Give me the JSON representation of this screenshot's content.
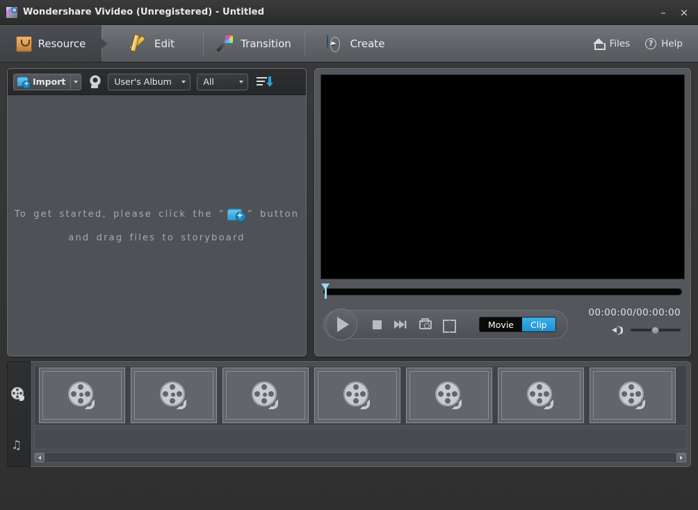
{
  "window": {
    "title": "Wondershare Vivideo (Unregistered) - Untitled",
    "logo_icon": "app-logo-icon",
    "minimize_label": "–",
    "close_label": "×"
  },
  "tabs": [
    {
      "label": "Resource",
      "icon": "shopping-bag-icon",
      "active": true
    },
    {
      "label": "Edit",
      "icon": "pencil-ruler-icon",
      "active": false
    },
    {
      "label": "Transition",
      "icon": "magic-wand-icon",
      "active": false
    },
    {
      "label": "Create",
      "icon": "globe-cursor-icon",
      "active": false
    }
  ],
  "header_links": [
    {
      "label": "Files",
      "icon": "home-icon"
    },
    {
      "label": "Help",
      "icon": "question-circle-icon",
      "glyph": "?"
    }
  ],
  "resource_panel": {
    "toolbar": {
      "import_label": "Import",
      "import_icon": "folder-add-icon",
      "import_dropdown_icon": "chevron-down-icon",
      "webcam_icon": "webcam-icon",
      "album_select": {
        "value": "User's Album",
        "options": [
          "User's Album"
        ]
      },
      "filter_select": {
        "value": "All",
        "options": [
          "All"
        ]
      },
      "sort_icon": "sort-descending-icon"
    },
    "empty_state": {
      "line1_before": "To  get  started,  please  click  the  “",
      "line1_icon": "folder-add-icon",
      "line1_after": "”  button",
      "line2": "and  drag  files  to  storyboard"
    }
  },
  "preview_panel": {
    "video_background": "#000000",
    "seek": {
      "playhead_position_pct": 0,
      "playhead_color": "#9ed4f5"
    },
    "transport": [
      {
        "name": "play-button",
        "icon": "play-icon"
      },
      {
        "name": "stop-button",
        "icon": "stop-icon"
      },
      {
        "name": "next-frame-button",
        "icon": "next-frame-icon"
      },
      {
        "name": "snapshot-button",
        "icon": "camera-icon"
      },
      {
        "name": "fullscreen-button",
        "icon": "fullscreen-icon"
      }
    ],
    "mode_toggle": {
      "movie_label": "Movie",
      "clip_label": "Clip",
      "selected": "Clip",
      "active_color": "#1d8fd0"
    },
    "timecode": "00:00:00/00:00:00",
    "volume": {
      "icon": "speaker-icon",
      "level_pct": 45
    }
  },
  "storyboard": {
    "rail": [
      {
        "name": "video-track-button",
        "icon": "film-reel-icon",
        "active": true
      },
      {
        "name": "audio-track-button",
        "icon": "music-note-icon",
        "glyph": "♫",
        "active": false
      }
    ],
    "slots": [
      {
        "icon": "film-reel-icon"
      },
      {
        "icon": "film-reel-icon"
      },
      {
        "icon": "film-reel-icon"
      },
      {
        "icon": "film-reel-icon"
      },
      {
        "icon": "film-reel-icon"
      },
      {
        "icon": "film-reel-icon"
      },
      {
        "icon": "film-reel-icon"
      }
    ],
    "scrollbar": {
      "left_arrow_icon": "chevron-left-icon",
      "right_arrow_icon": "chevron-right-icon"
    }
  },
  "colors": {
    "app_background": "#343434",
    "panel_background": "#4e5156",
    "toolbar_dark": "#2a2c2e",
    "accent_blue": "#1d8fd0",
    "text_primary": "#e6e8ea",
    "text_muted": "#a7abaf"
  }
}
